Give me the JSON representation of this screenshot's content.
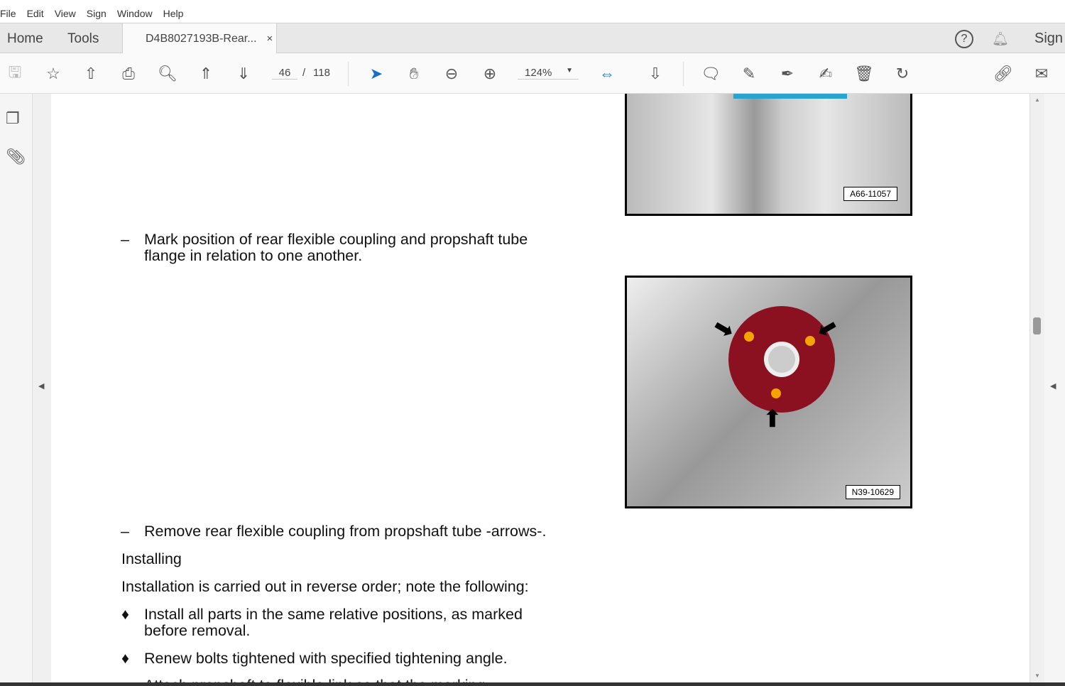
{
  "menu": [
    "File",
    "Edit",
    "View",
    "Sign",
    "Window",
    "Help"
  ],
  "tabs": {
    "home": "Home",
    "tools": "Tools",
    "document": "D4B8027193B-Rear...",
    "close": "×",
    "sign": "Sign"
  },
  "toolbar": {
    "page_current": "46",
    "page_sep": "/",
    "page_total": "118",
    "zoom": "124%"
  },
  "figures": [
    {
      "label": "A66-11057"
    },
    {
      "label": "N39-10629"
    }
  ],
  "content": {
    "step1_dash": "–",
    "step1": "Mark position of rear flexible coupling and propshaft tube",
    "step1b": "flange in relation to one another.",
    "step2_dash": "–",
    "step2": "Remove rear flexible coupling from propshaft tube -arrows-.",
    "heading": "Installing",
    "intro": "Installation is carried out in reverse order; note the following:",
    "bullet": "♦",
    "b1": "Install all parts in the same relative positions, as marked",
    "b1b": "before removal.",
    "b2": "Renew bolts tightened with specified tightening angle.",
    "b3": "Attach propshaft to flexible link so that the marking"
  }
}
